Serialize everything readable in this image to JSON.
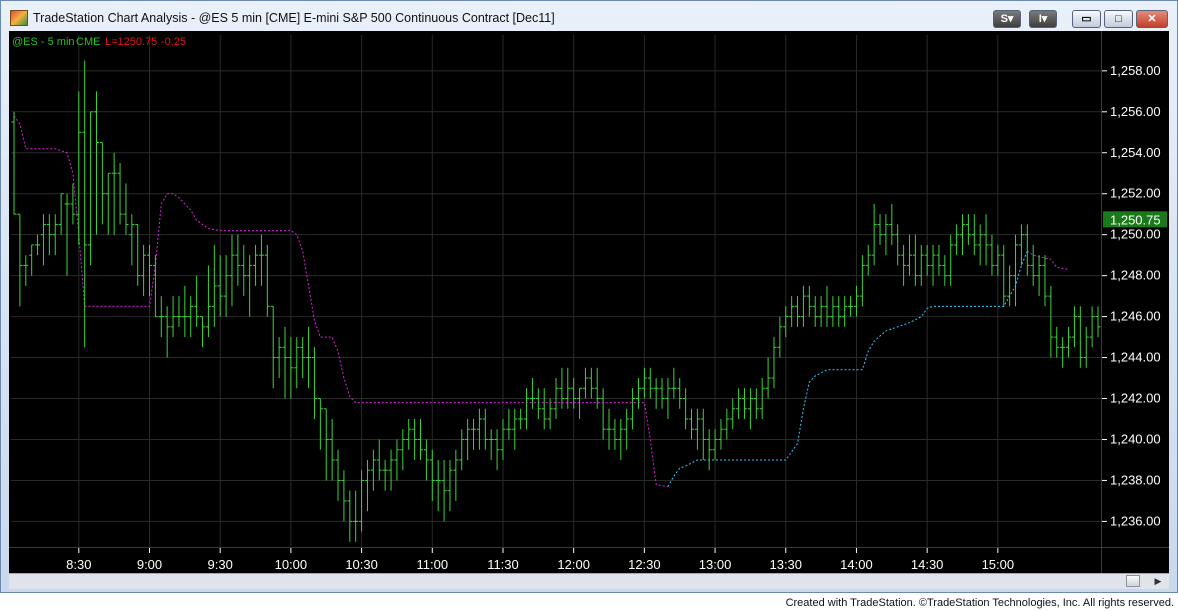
{
  "window": {
    "title": "TradeStation Chart Analysis - @ES 5 min [CME] E-mini S&P 500 Continuous Contract [Dec11]",
    "buttons": {
      "s": "S",
      "s_arrow": "▾",
      "i": "I",
      "i_arrow": "▾",
      "minimize": "▭",
      "maximize": "□",
      "close": "✕"
    }
  },
  "legend": {
    "symbol": "@ES - 5 min",
    "exchange": "CME",
    "last": "L=1250.75",
    "change": "-0.25"
  },
  "footer": "Created with TradeStation. ©TradeStation Technologies, Inc. All rights reserved.",
  "colors": {
    "background": "#000000",
    "bar": "#3ad43a",
    "stop_short": "#e020e0",
    "stop_long": "#30c8ff",
    "grid": "#2a2a2a",
    "price_badge": "#1a7a1a",
    "legend_green": "#27c227",
    "legend_red": "#e01818",
    "axis_red": "#c00000"
  },
  "chart_data": {
    "type": "ohlc",
    "symbol": "@ES",
    "interval": "5 min",
    "last_price": "1,250.75",
    "ylim": [
      1234.75,
      1259.75
    ],
    "y_ticks": [
      "1,236.00",
      "1,238.00",
      "1,240.00",
      "1,242.00",
      "1,244.00",
      "1,246.00",
      "1,248.00",
      "1,250.00",
      "1,252.00",
      "1,254.00",
      "1,256.00",
      "1,258.00"
    ],
    "y_tick_values": [
      1236,
      1238,
      1240,
      1242,
      1244,
      1246,
      1248,
      1250,
      1252,
      1254,
      1256,
      1258
    ],
    "x_ticks": [
      "8:30",
      "9:00",
      "9:30",
      "10:00",
      "10:30",
      "11:00",
      "11:30",
      "12:00",
      "12:30",
      "13:00",
      "13:30",
      "14:00",
      "14:30",
      "15:00"
    ],
    "x_tick_bar_index": [
      11,
      23,
      35,
      47,
      59,
      71,
      83,
      95,
      107,
      119,
      131,
      143,
      155,
      167
    ],
    "bars": [
      [
        1255.5,
        1256.0,
        1251.0,
        1251.0
      ],
      [
        1251.0,
        1251.0,
        1246.5,
        1248.5
      ],
      [
        1248.5,
        1249.0,
        1247.5,
        1248.5
      ],
      [
        1249.0,
        1249.5,
        1248.0,
        1249.5
      ],
      [
        1249.5,
        1250.0,
        1249.0,
        1249.5
      ],
      [
        1250.0,
        1251.0,
        1248.5,
        1250.5
      ],
      [
        1250.5,
        1251.0,
        1249.0,
        1250.0
      ],
      [
        1250.0,
        1251.0,
        1249.0,
        1250.5
      ],
      [
        1250.5,
        1252.0,
        1250.0,
        1252.0
      ],
      [
        1251.5,
        1252.0,
        1248.0,
        1251.5
      ],
      [
        1251.5,
        1252.5,
        1250.5,
        1251.0
      ],
      [
        1251.0,
        1257.0,
        1249.5,
        1255.0
      ],
      [
        1255.0,
        1258.5,
        1244.5,
        1249.5
      ],
      [
        1249.5,
        1256.0,
        1248.5,
        1256.0
      ],
      [
        1256.0,
        1257.0,
        1250.0,
        1254.5
      ],
      [
        1254.5,
        1254.5,
        1250.5,
        1252.0
      ],
      [
        1252.0,
        1253.0,
        1250.0,
        1253.0
      ],
      [
        1253.0,
        1254.0,
        1250.0,
        1253.0
      ],
      [
        1253.0,
        1253.5,
        1250.5,
        1251.0
      ],
      [
        1251.0,
        1252.5,
        1250.0,
        1250.5
      ],
      [
        1250.0,
        1251.0,
        1248.5,
        1250.5
      ],
      [
        1250.5,
        1250.5,
        1247.5,
        1248.0
      ],
      [
        1248.0,
        1249.5,
        1247.0,
        1249.0
      ],
      [
        1249.0,
        1249.5,
        1247.0,
        1248.5
      ],
      [
        1248.5,
        1249.0,
        1246.0,
        1246.0
      ],
      [
        1246.0,
        1247.0,
        1245.0,
        1246.0
      ],
      [
        1246.0,
        1246.5,
        1244.0,
        1245.5
      ],
      [
        1245.5,
        1247.0,
        1245.0,
        1246.0
      ],
      [
        1246.0,
        1247.0,
        1245.5,
        1246.0
      ],
      [
        1246.0,
        1247.5,
        1245.0,
        1246.0
      ],
      [
        1246.0,
        1247.0,
        1245.0,
        1246.5
      ],
      [
        1246.5,
        1248.0,
        1245.5,
        1246.0
      ],
      [
        1246.0,
        1246.0,
        1244.5,
        1245.5
      ],
      [
        1245.5,
        1248.5,
        1245.0,
        1246.5
      ],
      [
        1246.5,
        1249.5,
        1245.5,
        1247.5
      ],
      [
        1247.5,
        1249.0,
        1246.0,
        1247.0
      ],
      [
        1247.0,
        1249.0,
        1246.0,
        1248.0
      ],
      [
        1248.0,
        1250.0,
        1246.5,
        1249.0
      ],
      [
        1249.0,
        1250.0,
        1247.5,
        1248.5
      ],
      [
        1248.5,
        1249.5,
        1247.0,
        1248.0
      ],
      [
        1248.0,
        1249.0,
        1246.0,
        1248.5
      ],
      [
        1248.5,
        1249.5,
        1247.5,
        1249.0
      ],
      [
        1249.0,
        1250.0,
        1247.5,
        1249.0
      ],
      [
        1249.0,
        1249.5,
        1246.0,
        1246.5
      ],
      [
        1246.5,
        1246.5,
        1242.5,
        1244.0
      ],
      [
        1244.0,
        1245.0,
        1243.0,
        1244.5
      ],
      [
        1244.5,
        1245.5,
        1242.0,
        1244.0
      ],
      [
        1244.0,
        1245.0,
        1242.0,
        1243.5
      ],
      [
        1243.5,
        1245.0,
        1242.5,
        1244.5
      ],
      [
        1244.5,
        1245.0,
        1243.0,
        1244.0
      ],
      [
        1244.0,
        1245.5,
        1242.5,
        1244.0
      ],
      [
        1244.0,
        1244.5,
        1241.0,
        1242.0
      ],
      [
        1242.0,
        1242.0,
        1239.5,
        1241.5
      ],
      [
        1241.5,
        1241.5,
        1238.0,
        1240.0
      ],
      [
        1240.0,
        1241.0,
        1238.0,
        1239.0
      ],
      [
        1239.0,
        1239.5,
        1237.0,
        1238.0
      ],
      [
        1238.0,
        1238.5,
        1236.0,
        1237.0
      ],
      [
        1237.0,
        1237.5,
        1235.0,
        1236.0
      ],
      [
        1236.0,
        1237.5,
        1235.0,
        1236.0
      ],
      [
        1236.0,
        1238.5,
        1235.5,
        1238.0
      ],
      [
        1238.0,
        1239.0,
        1236.5,
        1238.5
      ],
      [
        1238.5,
        1239.5,
        1237.5,
        1239.0
      ],
      [
        1239.0,
        1240.0,
        1238.0,
        1238.5
      ],
      [
        1238.5,
        1239.0,
        1237.5,
        1238.5
      ],
      [
        1238.5,
        1239.5,
        1237.5,
        1239.0
      ],
      [
        1239.0,
        1240.0,
        1238.0,
        1239.5
      ],
      [
        1239.5,
        1240.5,
        1238.5,
        1240.0
      ],
      [
        1240.0,
        1241.0,
        1239.5,
        1240.5
      ],
      [
        1240.5,
        1241.0,
        1239.0,
        1240.0
      ],
      [
        1240.0,
        1241.0,
        1239.0,
        1239.5
      ],
      [
        1239.5,
        1240.0,
        1238.0,
        1239.0
      ],
      [
        1239.0,
        1239.5,
        1237.0,
        1238.0
      ],
      [
        1238.0,
        1239.0,
        1236.5,
        1238.0
      ],
      [
        1238.0,
        1239.0,
        1236.0,
        1237.5
      ],
      [
        1237.5,
        1239.0,
        1236.5,
        1238.5
      ],
      [
        1238.5,
        1239.5,
        1237.0,
        1239.0
      ],
      [
        1239.0,
        1240.5,
        1238.5,
        1240.0
      ],
      [
        1240.0,
        1241.0,
        1239.0,
        1240.5
      ],
      [
        1240.5,
        1241.0,
        1239.5,
        1240.5
      ],
      [
        1240.5,
        1241.5,
        1239.5,
        1241.0
      ],
      [
        1241.0,
        1241.5,
        1239.5,
        1240.0
      ],
      [
        1240.0,
        1240.5,
        1239.0,
        1240.0
      ],
      [
        1240.0,
        1240.5,
        1238.5,
        1239.5
      ],
      [
        1239.5,
        1241.0,
        1239.0,
        1240.5
      ],
      [
        1240.5,
        1241.5,
        1240.0,
        1240.5
      ],
      [
        1240.5,
        1241.5,
        1239.5,
        1241.0
      ],
      [
        1241.0,
        1241.5,
        1240.5,
        1241.0
      ],
      [
        1241.0,
        1242.5,
        1240.5,
        1242.0
      ],
      [
        1242.0,
        1243.0,
        1241.5,
        1242.0
      ],
      [
        1242.0,
        1242.5,
        1241.0,
        1241.5
      ],
      [
        1241.5,
        1242.5,
        1240.5,
        1241.0
      ],
      [
        1241.0,
        1242.0,
        1240.5,
        1241.5
      ],
      [
        1241.5,
        1243.0,
        1241.0,
        1242.5
      ],
      [
        1242.5,
        1243.5,
        1241.5,
        1242.0
      ],
      [
        1242.0,
        1243.5,
        1241.5,
        1242.5
      ],
      [
        1242.5,
        1243.0,
        1241.5,
        1242.0
      ],
      [
        1242.0,
        1242.5,
        1241.0,
        1242.5
      ],
      [
        1242.5,
        1243.5,
        1242.0,
        1243.0
      ],
      [
        1243.0,
        1243.5,
        1242.0,
        1242.5
      ],
      [
        1242.5,
        1243.5,
        1241.5,
        1242.0
      ],
      [
        1242.0,
        1242.5,
        1240.0,
        1240.5
      ],
      [
        1240.5,
        1241.5,
        1239.5,
        1240.5
      ],
      [
        1240.5,
        1241.0,
        1239.5,
        1240.0
      ],
      [
        1240.0,
        1241.0,
        1239.0,
        1240.5
      ],
      [
        1240.5,
        1241.5,
        1239.5,
        1241.0
      ],
      [
        1241.0,
        1242.5,
        1240.5,
        1242.0
      ],
      [
        1242.0,
        1243.0,
        1241.5,
        1242.5
      ],
      [
        1242.5,
        1243.5,
        1242.0,
        1243.0
      ],
      [
        1243.0,
        1243.5,
        1242.0,
        1242.5
      ],
      [
        1242.5,
        1243.0,
        1241.5,
        1242.5
      ],
      [
        1242.5,
        1243.0,
        1241.5,
        1242.0
      ],
      [
        1242.0,
        1243.0,
        1241.0,
        1242.5
      ],
      [
        1242.5,
        1243.5,
        1242.0,
        1242.5
      ],
      [
        1242.5,
        1243.0,
        1241.5,
        1242.0
      ],
      [
        1242.0,
        1242.5,
        1240.5,
        1241.0
      ],
      [
        1241.0,
        1241.5,
        1240.0,
        1240.5
      ],
      [
        1240.5,
        1241.5,
        1239.5,
        1241.0
      ],
      [
        1241.0,
        1241.5,
        1239.0,
        1240.0
      ],
      [
        1240.0,
        1240.5,
        1238.5,
        1239.5
      ],
      [
        1239.5,
        1240.5,
        1239.0,
        1240.0
      ],
      [
        1240.0,
        1241.0,
        1239.5,
        1240.5
      ],
      [
        1240.5,
        1241.5,
        1240.0,
        1241.0
      ],
      [
        1241.0,
        1242.0,
        1240.5,
        1241.5
      ],
      [
        1241.5,
        1242.5,
        1241.0,
        1242.0
      ],
      [
        1242.0,
        1242.5,
        1241.0,
        1241.5
      ],
      [
        1241.5,
        1242.5,
        1240.5,
        1242.0
      ],
      [
        1242.0,
        1242.5,
        1241.0,
        1241.5
      ],
      [
        1241.5,
        1243.0,
        1241.0,
        1242.5
      ],
      [
        1242.5,
        1244.0,
        1242.0,
        1243.0
      ],
      [
        1243.0,
        1245.0,
        1242.5,
        1244.5
      ],
      [
        1244.5,
        1246.0,
        1244.0,
        1245.5
      ],
      [
        1245.5,
        1246.5,
        1245.0,
        1246.0
      ],
      [
        1246.0,
        1247.0,
        1245.5,
        1246.5
      ],
      [
        1246.5,
        1247.0,
        1245.5,
        1246.0
      ],
      [
        1246.0,
        1247.5,
        1245.5,
        1247.0
      ],
      [
        1247.0,
        1247.5,
        1246.0,
        1246.5
      ],
      [
        1246.5,
        1247.0,
        1245.5,
        1246.0
      ],
      [
        1246.0,
        1247.0,
        1245.5,
        1246.5
      ],
      [
        1246.5,
        1247.5,
        1245.5,
        1246.0
      ],
      [
        1246.0,
        1247.0,
        1245.5,
        1246.5
      ],
      [
        1246.5,
        1247.0,
        1245.5,
        1246.0
      ],
      [
        1246.0,
        1247.0,
        1245.5,
        1246.5
      ],
      [
        1246.5,
        1247.0,
        1246.0,
        1246.5
      ],
      [
        1246.5,
        1247.5,
        1246.0,
        1247.0
      ],
      [
        1247.0,
        1249.0,
        1246.5,
        1248.5
      ],
      [
        1248.5,
        1249.5,
        1248.0,
        1249.0
      ],
      [
        1249.0,
        1251.5,
        1248.5,
        1250.5
      ],
      [
        1250.5,
        1251.0,
        1249.5,
        1250.0
      ],
      [
        1250.0,
        1251.0,
        1249.0,
        1250.5
      ],
      [
        1250.5,
        1251.5,
        1249.5,
        1250.0
      ],
      [
        1250.0,
        1250.5,
        1248.5,
        1249.0
      ],
      [
        1249.0,
        1249.5,
        1247.5,
        1248.5
      ],
      [
        1248.5,
        1250.0,
        1248.0,
        1249.0
      ],
      [
        1249.0,
        1250.0,
        1247.5,
        1248.0
      ],
      [
        1248.0,
        1249.5,
        1247.5,
        1249.0
      ],
      [
        1249.0,
        1249.5,
        1248.0,
        1248.5
      ],
      [
        1248.5,
        1249.5,
        1247.5,
        1249.0
      ],
      [
        1249.0,
        1249.5,
        1248.0,
        1248.5
      ],
      [
        1248.5,
        1249.0,
        1247.5,
        1248.0
      ],
      [
        1248.0,
        1250.0,
        1247.5,
        1249.5
      ],
      [
        1249.5,
        1250.5,
        1249.0,
        1250.0
      ],
      [
        1250.0,
        1251.0,
        1249.0,
        1250.5
      ],
      [
        1250.5,
        1251.0,
        1249.5,
        1250.0
      ],
      [
        1250.0,
        1251.0,
        1249.0,
        1249.5
      ],
      [
        1249.5,
        1250.5,
        1248.5,
        1250.0
      ],
      [
        1250.0,
        1251.0,
        1248.5,
        1249.5
      ],
      [
        1249.5,
        1250.0,
        1248.0,
        1248.5
      ],
      [
        1248.5,
        1249.5,
        1248.0,
        1249.0
      ],
      [
        1249.0,
        1249.5,
        1246.5,
        1247.0
      ],
      [
        1247.0,
        1248.5,
        1246.5,
        1248.0
      ],
      [
        1248.0,
        1250.0,
        1246.5,
        1249.5
      ],
      [
        1249.5,
        1250.5,
        1248.5,
        1250.0
      ],
      [
        1250.0,
        1250.5,
        1248.0,
        1248.5
      ],
      [
        1248.5,
        1249.5,
        1247.5,
        1248.0
      ],
      [
        1248.0,
        1249.0,
        1247.0,
        1248.5
      ],
      [
        1248.5,
        1249.0,
        1246.5,
        1247.0
      ],
      [
        1247.0,
        1247.5,
        1244.0,
        1245.0
      ],
      [
        1245.0,
        1245.5,
        1244.0,
        1244.5
      ],
      [
        1244.5,
        1245.0,
        1243.5,
        1244.5
      ],
      [
        1244.5,
        1245.5,
        1244.0,
        1245.0
      ],
      [
        1245.0,
        1246.5,
        1244.5,
        1246.0
      ],
      [
        1246.0,
        1246.5,
        1243.5,
        1244.0
      ],
      [
        1244.0,
        1245.5,
        1243.5,
        1245.0
      ],
      [
        1245.0,
        1246.5,
        1244.5,
        1246.0
      ],
      [
        1246.0,
        1246.5,
        1245.0,
        1245.5
      ]
    ],
    "short_stop": [
      [
        0,
        1255.8
      ],
      [
        1,
        1255.4
      ],
      [
        2,
        1254.2
      ],
      [
        7,
        1254.2
      ],
      [
        9,
        1254.0
      ],
      [
        10,
        1253.0
      ],
      [
        11,
        1250.0
      ],
      [
        12,
        1246.5
      ],
      [
        23,
        1246.5
      ],
      [
        24,
        1248.5
      ],
      [
        25,
        1251.5
      ],
      [
        26,
        1252.0
      ],
      [
        27,
        1252.0
      ],
      [
        28,
        1251.8
      ],
      [
        30,
        1251.2
      ],
      [
        31,
        1250.7
      ],
      [
        33,
        1250.3
      ],
      [
        35,
        1250.2
      ],
      [
        47,
        1250.2
      ],
      [
        48,
        1250.0
      ],
      [
        49,
        1249.2
      ],
      [
        50,
        1247.5
      ],
      [
        51,
        1245.8
      ],
      [
        52,
        1245.0
      ],
      [
        54,
        1245.0
      ],
      [
        55,
        1244.3
      ],
      [
        56,
        1243.0
      ],
      [
        57,
        1242.1
      ],
      [
        58,
        1241.8
      ],
      [
        107,
        1241.8
      ],
      [
        108,
        1240.0
      ],
      [
        109,
        1237.8
      ],
      [
        111,
        1237.7
      ]
    ],
    "long_stop": [
      [
        111,
        1237.7
      ],
      [
        112,
        1238.2
      ],
      [
        113,
        1238.6
      ],
      [
        114,
        1238.7
      ],
      [
        116,
        1239.0
      ],
      [
        131,
        1239.0
      ],
      [
        133,
        1239.8
      ],
      [
        134,
        1241.5
      ],
      [
        135,
        1242.8
      ],
      [
        136,
        1243.1
      ],
      [
        138,
        1243.4
      ],
      [
        144,
        1243.4
      ],
      [
        145,
        1244.3
      ],
      [
        146,
        1244.8
      ],
      [
        148,
        1245.3
      ],
      [
        150,
        1245.5
      ],
      [
        152,
        1245.7
      ],
      [
        154,
        1246.0
      ],
      [
        155,
        1246.4
      ],
      [
        156,
        1246.5
      ],
      [
        162,
        1246.5
      ],
      [
        164,
        1246.5
      ],
      [
        166,
        1246.5
      ],
      [
        168,
        1246.5
      ],
      [
        170,
        1247.5
      ],
      [
        171,
        1248.5
      ],
      [
        172,
        1249.2
      ]
    ],
    "tail_short_stop": [
      [
        172,
        1249.2
      ],
      [
        173,
        1249.0
      ],
      [
        176,
        1248.8
      ],
      [
        177,
        1248.4
      ],
      [
        179,
        1248.3
      ]
    ]
  }
}
